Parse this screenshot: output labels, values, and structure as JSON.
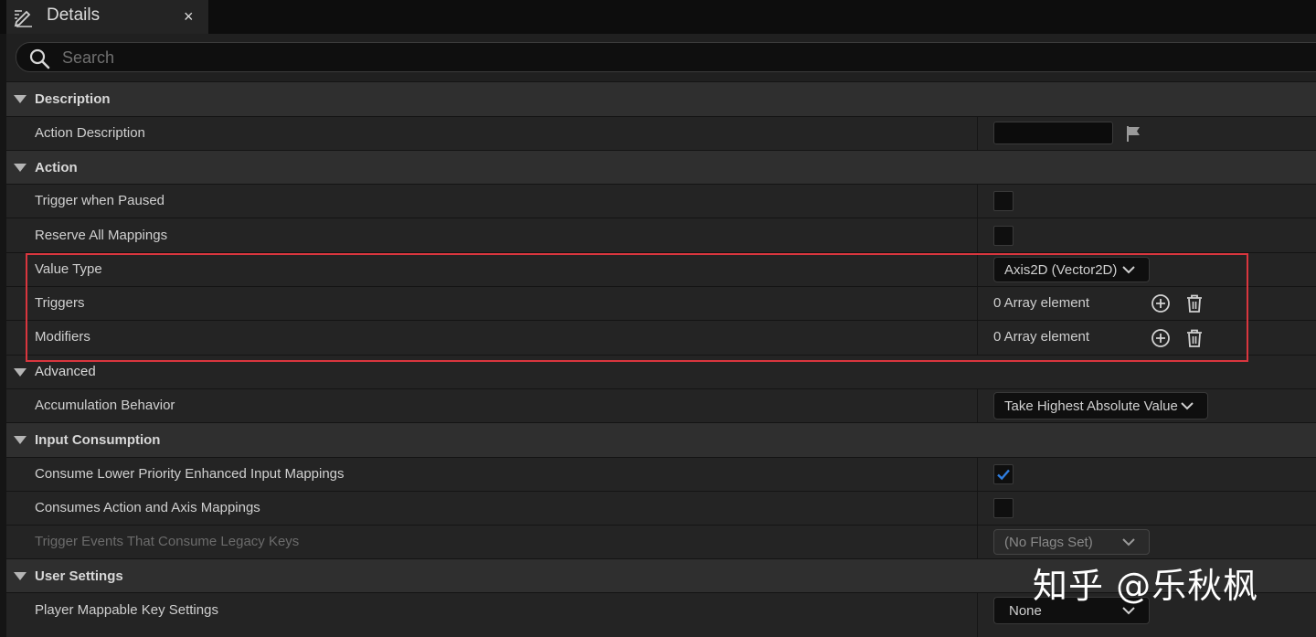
{
  "tab": {
    "title": "Details",
    "close": "×"
  },
  "search": {
    "placeholder": "Search",
    "value": ""
  },
  "sections": {
    "description": {
      "title": "Description",
      "action_description": {
        "label": "Action Description",
        "value": ""
      }
    },
    "action": {
      "title": "Action",
      "trigger_when_paused": {
        "label": "Trigger when Paused",
        "checked": false
      },
      "reserve_all_mappings": {
        "label": "Reserve All Mappings",
        "checked": false
      },
      "value_type": {
        "label": "Value Type",
        "value": "Axis2D (Vector2D)"
      },
      "triggers": {
        "label": "Triggers",
        "value": "0 Array element"
      },
      "modifiers": {
        "label": "Modifiers",
        "value": "0 Array element"
      }
    },
    "advanced": {
      "title": "Advanced",
      "accumulation_behavior": {
        "label": "Accumulation Behavior",
        "value": "Take Highest Absolute Value"
      }
    },
    "input_consumption": {
      "title": "Input Consumption",
      "consume_lower_priority": {
        "label": "Consume Lower Priority Enhanced Input Mappings",
        "checked": true
      },
      "consumes_action_axis": {
        "label": "Consumes Action and Axis Mappings",
        "checked": false
      },
      "trigger_events_legacy": {
        "label": "Trigger Events That Consume Legacy Keys",
        "value": "(No Flags Set)"
      }
    },
    "user_settings": {
      "title": "User Settings",
      "player_mappable": {
        "label": "Player Mappable Key Settings",
        "value": "None"
      }
    }
  },
  "watermark": "知乎 @乐秋枫",
  "colors": {
    "checkbox_check": "#2f7ee0",
    "highlight_border": "#d9363e"
  },
  "icons": {
    "tab": "pencil-icon",
    "search": "search-icon",
    "flag": "flag-icon",
    "add": "add-circle-icon",
    "delete": "trash-icon",
    "dropdown": "chevron-down-icon",
    "collapse": "triangle-down-icon"
  }
}
